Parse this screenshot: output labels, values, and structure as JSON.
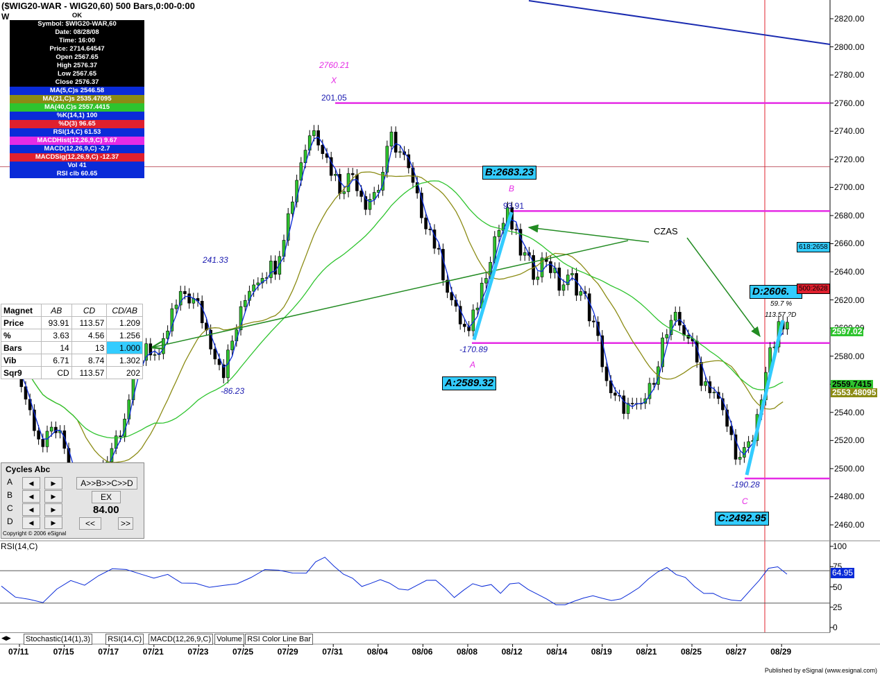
{
  "header": {
    "title": "($WIG20-WAR - WIG20,60) 500 Bars,0:00-0:00",
    "sub": "W"
  },
  "info_panel": [
    {
      "text": "OK",
      "bg": "#ffffff",
      "fg": "#000000"
    },
    {
      "text": "Symbol: $WIG20-WAR,60",
      "bg": "#000000",
      "fg": "#ffffff"
    },
    {
      "text": "Date: 08/28/08",
      "bg": "#000000",
      "fg": "#ffffff"
    },
    {
      "text": "Time: 16:00",
      "bg": "#000000",
      "fg": "#ffffff"
    },
    {
      "text": "Price: 2714.64547",
      "bg": "#000000",
      "fg": "#ffffff"
    },
    {
      "text": "Open 2567.65",
      "bg": "#000000",
      "fg": "#ffffff"
    },
    {
      "text": "High 2576.37",
      "bg": "#000000",
      "fg": "#ffffff"
    },
    {
      "text": "Low 2567.65",
      "bg": "#000000",
      "fg": "#ffffff"
    },
    {
      "text": "Close 2576.37",
      "bg": "#000000",
      "fg": "#ffffff"
    },
    {
      "text": "MA(5,C)s 2546.58",
      "bg": "#0a2bd8",
      "fg": "#ffffff"
    },
    {
      "text": "MA(21,C)s 2535.47095",
      "bg": "#8b8b14",
      "fg": "#ffffff"
    },
    {
      "text": "MA(40,C)s 2557.4415",
      "bg": "#2ec42e",
      "fg": "#ffffff"
    },
    {
      "text": "%K(14,1) 100",
      "bg": "#0a2bd8",
      "fg": "#ffffff"
    },
    {
      "text": "%D(3) 96.65",
      "bg": "#e0202e",
      "fg": "#ffffff"
    },
    {
      "text": "RSI(14,C) 61.53",
      "bg": "#0a2bd8",
      "fg": "#ffffff"
    },
    {
      "text": "MACDHist(12,26,9,C) 9.67",
      "bg": "#e52be5",
      "fg": "#ffffff"
    },
    {
      "text": "MACD(12,26,9,C) -2.7",
      "bg": "#0a2bd8",
      "fg": "#ffffff"
    },
    {
      "text": "MACDSig(12,26,9,C) -12.37",
      "bg": "#e0202e",
      "fg": "#ffffff"
    },
    {
      "text": "Vol 41",
      "bg": "#0a2bd8",
      "fg": "#ffffff"
    },
    {
      "text": "RSI clb 60.65",
      "bg": "#0a2bd8",
      "fg": "#ffffff"
    }
  ],
  "magnet": {
    "headers": [
      "Magnet",
      "AB",
      "CD",
      "CD/AB"
    ],
    "rows": [
      [
        "Price",
        "93.91",
        "113.57",
        "1.209"
      ],
      [
        "%",
        "3.63",
        "4.56",
        "1.256"
      ],
      [
        "Bars",
        "14",
        "13",
        "1.000"
      ],
      [
        "Vib",
        "6.71",
        "8.74",
        "1.302"
      ],
      [
        "Sqr9",
        "CD",
        "113.57",
        "202"
      ]
    ]
  },
  "cycles": {
    "title": "Cycles Abc",
    "rows": [
      "A",
      "B",
      "C",
      "D"
    ],
    "left_buttons": [
      "◀",
      "◀",
      "◀",
      "◀"
    ],
    "right_buttons": [
      "▶",
      "▶",
      "▶",
      "▶"
    ],
    "label_abcd": "A>>B>>C>>D",
    "label_ex": "EX",
    "value": "84.00",
    "nav_back": "<<",
    "nav_fwd": ">>",
    "copyright": "Copyright © 2006 eSignal"
  },
  "chart_data": {
    "type": "candlestick",
    "symbol": "$WIG20-WAR",
    "interval": "60",
    "y_ticks": [
      2460,
      2480,
      2500,
      2520,
      2540,
      2560,
      2580,
      2600,
      2620,
      2640,
      2660,
      2680,
      2700,
      2720,
      2740,
      2760,
      2780,
      2800,
      2820
    ],
    "y_tick_labels": [
      "2460.00",
      "2480.00",
      "2500.00",
      "2520.00",
      "2540.00",
      "2560.00",
      "2580.00",
      "2600.00",
      "2620.00",
      "2640.00",
      "2660.00",
      "2680.00",
      "2700.00",
      "2720.00",
      "2740.00",
      "2760.00",
      "2780.00",
      "2800.00",
      "2820.00"
    ],
    "ylim": [
      2452,
      2830
    ],
    "x_labels": [
      "07/11",
      "07/15",
      "07/17",
      "07/21",
      "07/23",
      "07/25",
      "07/29",
      "07/31",
      "08/04",
      "08/06",
      "08/08",
      "08/12",
      "08/14",
      "08/19",
      "08/21",
      "08/25",
      "08/27",
      "08/29"
    ],
    "close_path": [
      [
        0,
        2590
      ],
      [
        1,
        2570
      ],
      [
        2,
        2540
      ],
      [
        3,
        2515
      ],
      [
        4,
        2530
      ],
      [
        5,
        2500
      ],
      [
        6,
        2470
      ],
      [
        7,
        2490
      ],
      [
        8,
        2510
      ],
      [
        9,
        2530
      ],
      [
        10,
        2560
      ],
      [
        11,
        2590
      ],
      [
        12,
        2575
      ],
      [
        13,
        2610
      ],
      [
        14,
        2625
      ],
      [
        15,
        2615
      ],
      [
        16,
        2590
      ],
      [
        17,
        2570
      ],
      [
        18,
        2600
      ],
      [
        19,
        2630
      ],
      [
        20,
        2640
      ],
      [
        21,
        2645
      ],
      [
        22,
        2680
      ],
      [
        23,
        2720
      ],
      [
        24,
        2745
      ],
      [
        25,
        2720
      ],
      [
        26,
        2700
      ],
      [
        27,
        2710
      ],
      [
        28,
        2690
      ],
      [
        29,
        2700
      ],
      [
        30,
        2735
      ],
      [
        31,
        2720
      ],
      [
        32,
        2690
      ],
      [
        33,
        2670
      ],
      [
        34,
        2640
      ],
      [
        35,
        2610
      ],
      [
        36,
        2595
      ],
      [
        37,
        2630
      ],
      [
        38,
        2665
      ],
      [
        39,
        2680
      ],
      [
        40,
        2655
      ],
      [
        41,
        2640
      ],
      [
        42,
        2650
      ],
      [
        43,
        2630
      ],
      [
        44,
        2635
      ],
      [
        45,
        2620
      ],
      [
        46,
        2590
      ],
      [
        47,
        2550
      ],
      [
        48,
        2545
      ],
      [
        49,
        2540
      ],
      [
        50,
        2555
      ],
      [
        51,
        2590
      ],
      [
        52,
        2605
      ],
      [
        53,
        2595
      ],
      [
        54,
        2565
      ],
      [
        55,
        2555
      ],
      [
        56,
        2530
      ],
      [
        57,
        2505
      ],
      [
        58,
        2520
      ],
      [
        59,
        2570
      ],
      [
        60,
        2598
      ],
      [
        61,
        2603
      ]
    ],
    "series": [
      {
        "name": "MA(5,C)s",
        "value": 2546.58
      },
      {
        "name": "MA(21,C)s",
        "value": 2535.47095
      },
      {
        "name": "MA(40,C)s",
        "value": 2557.4415
      }
    ],
    "horizontal_lines": [
      {
        "price": 2760,
        "color": "#e52be5"
      },
      {
        "price": 2683.23,
        "color": "#e52be5"
      },
      {
        "price": 2589.32,
        "color": "#e52be5"
      },
      {
        "price": 2492.95,
        "color": "#e52be5"
      }
    ],
    "price_tags": [
      {
        "text": "2597.02",
        "price": 2597.02,
        "bg": "#2ec42e",
        "fg": "#ffffff"
      },
      {
        "text": "2559.7415",
        "price": 2559.7415,
        "bg": "#2ec42e",
        "fg": "#000000"
      },
      {
        "text": "2553.48095",
        "price": 2553.48095,
        "bg": "#8b8b14",
        "fg": "#ffffff"
      },
      {
        "text": "618:2658",
        "price": 2658,
        "bg": "#33ccff",
        "fg": "#000000"
      },
      {
        "text": "500:2628",
        "price": 2628,
        "bg": "#e0202e",
        "fg": "#000000"
      }
    ],
    "annotations": {
      "x_price": "2760.21",
      "x_letter": "X",
      "x_bars": "201.05",
      "b_box": "B:2683.23",
      "b_letter": "B",
      "b_bars": "93.91",
      "a_box": "A:2589.32",
      "a_letter": "A",
      "a_bars": "-170.89",
      "c_box": "C:2492.95",
      "c_letter": "C",
      "c_bars": "-190.28",
      "d_box": "D:2606.",
      "d_pct": "59.7 %",
      "d_cd": "113.57 ?D",
      "czas": "CZAS",
      "p241": "241.33",
      "m86": "-86.23"
    },
    "rsi": {
      "label": "RSI(14,C)",
      "value": "64.95",
      "ticks": [
        "100",
        "75",
        "50",
        "25",
        "0"
      ],
      "ylim": [
        -5,
        110
      ],
      "levels": [
        70,
        30
      ],
      "path": [
        [
          0,
          55
        ],
        [
          3,
          40
        ],
        [
          6,
          35
        ],
        [
          9,
          30
        ],
        [
          12,
          45
        ],
        [
          15,
          60
        ],
        [
          18,
          55
        ],
        [
          21,
          60
        ],
        [
          24,
          70
        ],
        [
          27,
          75
        ],
        [
          30,
          68
        ],
        [
          33,
          60
        ],
        [
          36,
          62
        ],
        [
          39,
          58
        ],
        [
          42,
          55
        ],
        [
          45,
          50
        ],
        [
          48,
          48
        ],
        [
          51,
          52
        ],
        [
          54,
          60
        ],
        [
          57,
          70
        ],
        [
          60,
          74
        ],
        [
          63,
          67
        ],
        [
          66,
          70
        ],
        [
          68,
          78
        ],
        [
          70,
          88
        ],
        [
          72,
          74
        ],
        [
          74,
          62
        ],
        [
          76,
          58
        ],
        [
          78,
          54
        ],
        [
          80,
          58
        ],
        [
          82,
          60
        ],
        [
          84,
          55
        ],
        [
          86,
          50
        ],
        [
          88,
          46
        ],
        [
          90,
          53
        ],
        [
          92,
          60
        ],
        [
          94,
          62
        ],
        [
          96,
          50
        ],
        [
          98,
          40
        ],
        [
          100,
          48
        ],
        [
          102,
          53
        ],
        [
          104,
          48
        ],
        [
          106,
          50
        ],
        [
          108,
          44
        ],
        [
          110,
          52
        ],
        [
          112,
          56
        ],
        [
          114,
          48
        ],
        [
          116,
          40
        ],
        [
          118,
          36
        ],
        [
          120,
          30
        ],
        [
          122,
          28
        ],
        [
          124,
          34
        ],
        [
          126,
          40
        ],
        [
          128,
          38
        ],
        [
          130,
          34
        ],
        [
          132,
          30
        ],
        [
          134,
          34
        ],
        [
          136,
          42
        ],
        [
          138,
          52
        ],
        [
          140,
          62
        ],
        [
          142,
          72
        ],
        [
          144,
          72
        ],
        [
          146,
          68
        ],
        [
          148,
          60
        ],
        [
          150,
          52
        ],
        [
          152,
          45
        ],
        [
          154,
          40
        ],
        [
          156,
          34
        ],
        [
          158,
          32
        ],
        [
          160,
          36
        ],
        [
          162,
          45
        ],
        [
          164,
          55
        ],
        [
          166,
          70
        ],
        [
          168,
          72
        ],
        [
          170,
          68
        ]
      ]
    }
  },
  "tabs": [
    "Stochastic(14(1),3)",
    "RSI(14,C)",
    "MACD(12,26,9,C)",
    "Volume",
    "RSI Color Line Bar"
  ],
  "footer": "Published by eSignal (www.esignal.com)"
}
